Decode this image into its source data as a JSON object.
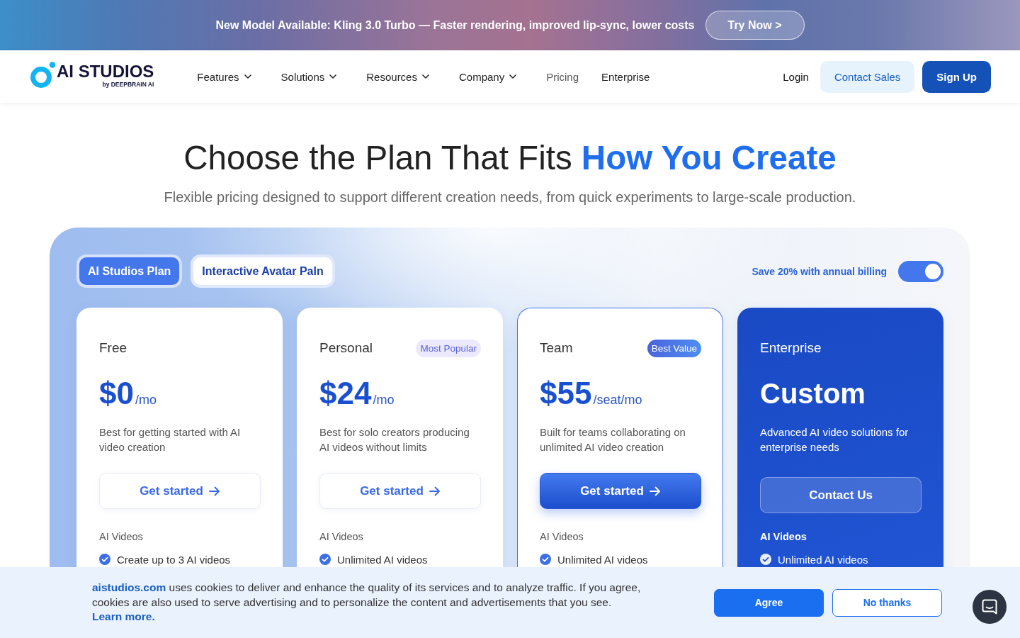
{
  "announcement": {
    "text": "New Model Available: Kling 3.0 Turbo — Faster rendering, improved lip-sync, lower costs",
    "button": "Try Now >"
  },
  "nav": {
    "logo": {
      "wordmark": "AI STUDIOS",
      "byline": "by DEEPBRAIN AI"
    },
    "items": [
      {
        "label": "Features",
        "has_menu": true,
        "selected": false
      },
      {
        "label": "Solutions",
        "has_menu": true,
        "selected": false
      },
      {
        "label": "Resources",
        "has_menu": true,
        "selected": false
      },
      {
        "label": "Company",
        "has_menu": true,
        "selected": false
      },
      {
        "label": "Pricing",
        "has_menu": false,
        "selected": true
      },
      {
        "label": "Enterprise",
        "has_menu": false,
        "selected": false
      }
    ],
    "login": "Login",
    "contact_sales": "Contact Sales",
    "sign_up": "Sign Up"
  },
  "hero": {
    "title": "Choose the Plan That Fits **How You Create**",
    "subtitle": "Flexible pricing designed to support different creation needs, from quick experiments to large-scale production."
  },
  "pricing": {
    "tabs": [
      {
        "label": "AI Studios Plan",
        "selected": true
      },
      {
        "label": "Interactive Avatar Paln",
        "selected": false
      }
    ],
    "billing": {
      "label": "Save 20% with annual billing",
      "on": true
    },
    "plans": [
      {
        "kind": "standard",
        "name": "Free",
        "price": "$0",
        "period": "/mo",
        "description": "Best for getting started with AI video creation",
        "button": {
          "label": "Get started",
          "arrow": true
        },
        "feature_group": "AI Videos",
        "features": [
          "Create up to 3 AI videos"
        ]
      },
      {
        "kind": "standard",
        "name": "Personal",
        "badge": {
          "text": "Most Popular",
          "kind": "soft"
        },
        "price": "$24",
        "period": "/mo",
        "description": "Best for solo creators producing AI videos without limits",
        "button": {
          "label": "Get started",
          "arrow": true
        },
        "feature_group": "AI Videos",
        "features": [
          "Unlimited AI videos"
        ]
      },
      {
        "kind": "featured",
        "name": "Team",
        "badge": {
          "text": "Best Value",
          "kind": "solid"
        },
        "price": "$55",
        "period": "/seat/mo",
        "description": "Built for teams collaborating on unlimited AI video creation",
        "button": {
          "label": "Get started",
          "arrow": true
        },
        "feature_group": "AI Videos",
        "features": [
          "Unlimited AI videos"
        ]
      },
      {
        "kind": "enterprise",
        "name": "Enterprise",
        "price": "Custom",
        "description": "Advanced AI video solutions for enterprise needs",
        "button": {
          "label": "Contact Us",
          "arrow": false
        },
        "feature_group": "AI Videos",
        "features": [
          "Unlimited AI videos"
        ]
      }
    ]
  },
  "cookie_banner": {
    "site_link": "aistudios.com",
    "text": "uses cookies to deliver and enhance the quality of its services and to analyze traffic. If you agree, cookies are also used to serve advertising and to personalize the content and advertisements that you see.",
    "learn_more": "Learn more.",
    "buttons": [
      {
        "label": "Agree",
        "kind": "accept"
      },
      {
        "label": "No thanks",
        "kind": "decline"
      }
    ]
  }
}
